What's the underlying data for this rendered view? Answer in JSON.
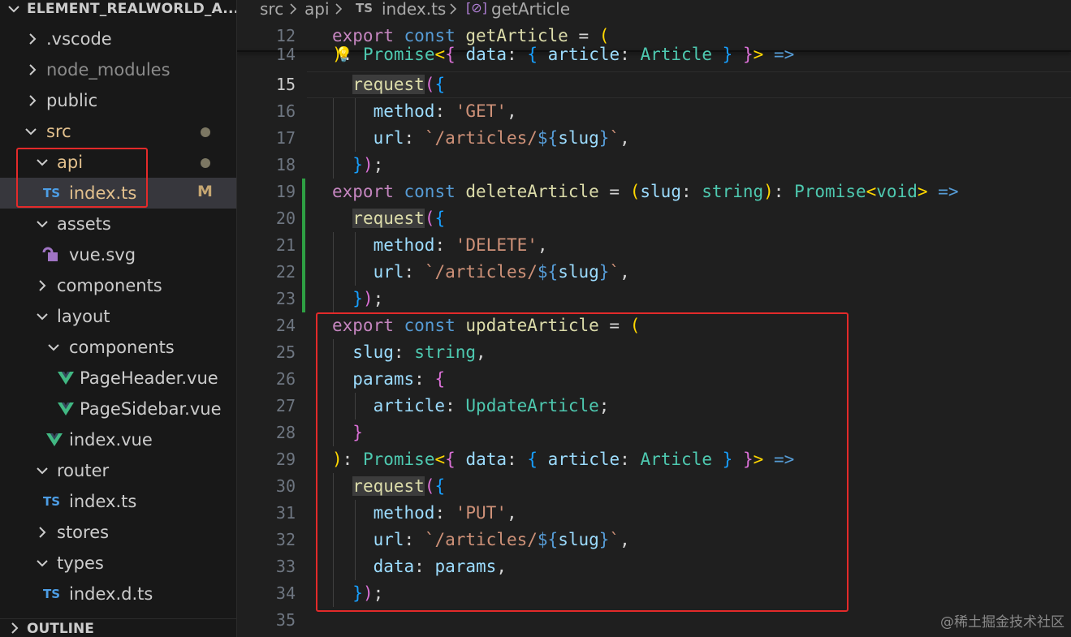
{
  "explorer": {
    "title": "ELEMENT_REALWORLD_A...",
    "items": [
      {
        "label": ".vscode"
      },
      {
        "label": "node_modules"
      },
      {
        "label": "public"
      },
      {
        "label": "src"
      },
      {
        "label": "api"
      },
      {
        "label": "index.ts",
        "icon": "TS",
        "badge": "M"
      },
      {
        "label": "assets"
      },
      {
        "label": "vue.svg"
      },
      {
        "label": "components"
      },
      {
        "label": "layout"
      },
      {
        "label": "components"
      },
      {
        "label": "PageHeader.vue"
      },
      {
        "label": "PageSidebar.vue"
      },
      {
        "label": "index.vue"
      },
      {
        "label": "router"
      },
      {
        "label": "index.ts",
        "icon": "TS"
      },
      {
        "label": "stores"
      },
      {
        "label": "types"
      },
      {
        "label": "index.d.ts",
        "icon": "TS"
      }
    ],
    "outline_label": "OUTLINE"
  },
  "breadcrumb": {
    "parts": [
      "src",
      "api",
      "index.ts",
      "getArticle"
    ],
    "file_icon": "TS",
    "symbol_icon": "[⊘]"
  },
  "editor": {
    "line_numbers": [
      "12",
      "14",
      "15",
      "16",
      "17",
      "18",
      "19",
      "20",
      "21",
      "22",
      "23",
      "24",
      "25",
      "26",
      "27",
      "28",
      "29",
      "30",
      "31",
      "32",
      "33",
      "34",
      "35"
    ],
    "current_line": "15"
  },
  "colors": {
    "keyword": "#c586c0",
    "storage": "#569cd6",
    "function": "#dcdcaa",
    "variable": "#9cdcfe",
    "type": "#4ec9b0",
    "string": "#ce9178",
    "highlight_box": "#e32a2a",
    "git_added": "#2ea043"
  },
  "watermark": "@稀土掘金技术社区"
}
